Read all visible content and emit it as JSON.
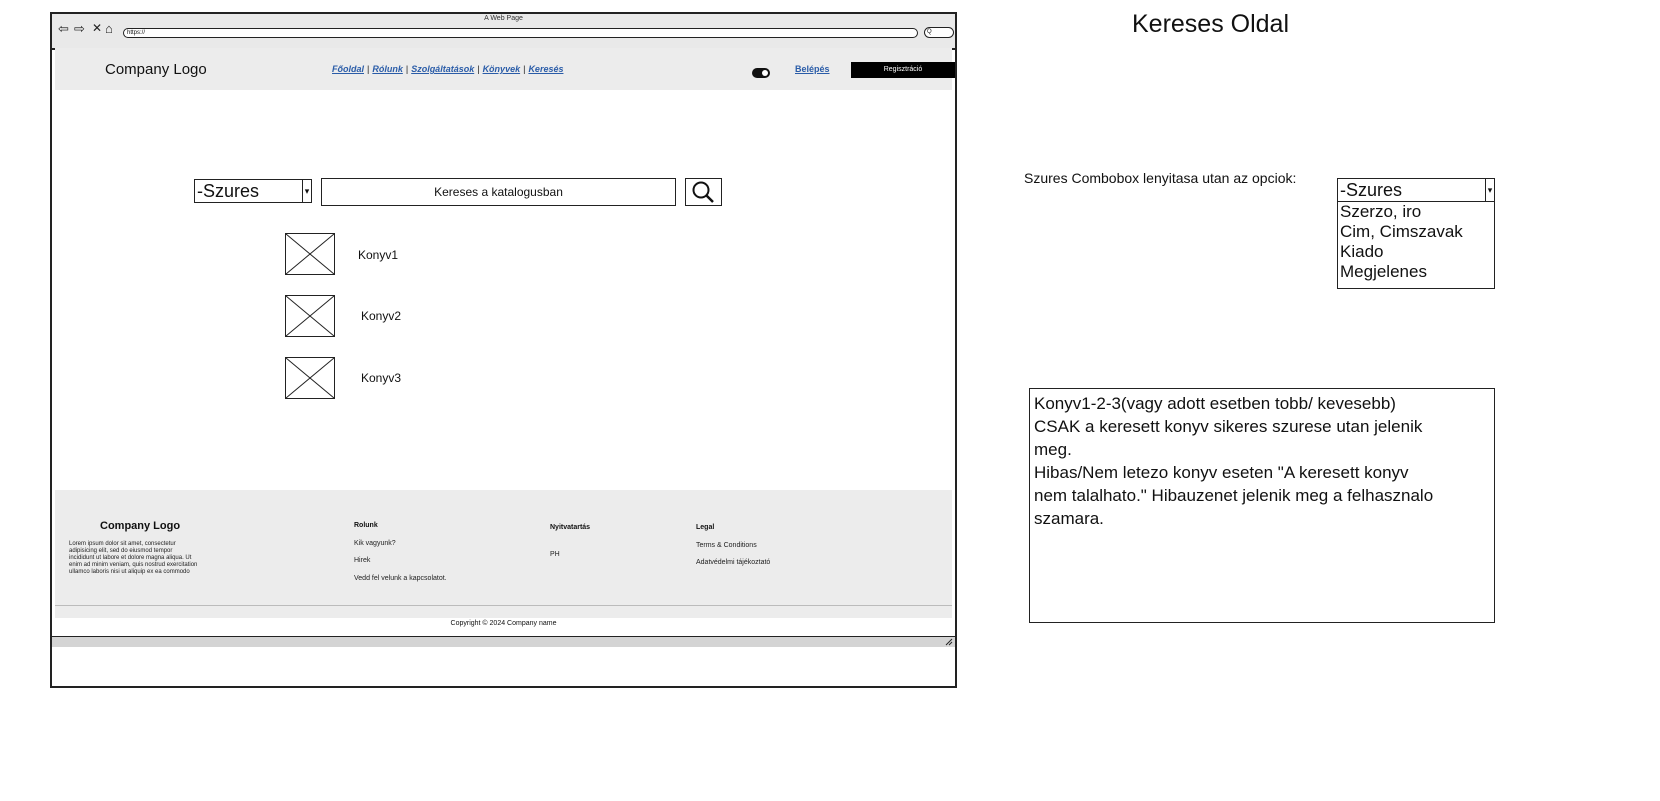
{
  "browser": {
    "title": "A Web Page",
    "address": "https://",
    "search": "Q",
    "controls": {
      "back": "⇦",
      "forward": "⇨",
      "stop": "✕",
      "home": "⌂"
    }
  },
  "header": {
    "logo": "Company Logo",
    "nav": [
      "Főoldal",
      "Rólunk",
      "Szolgáltatások",
      "Könyvek",
      "Keresés"
    ],
    "nav_separator": "|",
    "login": "Belépés",
    "register": "Regisztráció"
  },
  "search": {
    "filter_value": "-Szures",
    "input_text": "Kereses a katalogusban",
    "dropdown_arrow": "▾"
  },
  "results": [
    {
      "label": "Konyv1"
    },
    {
      "label": "Konyv2"
    },
    {
      "label": "Konyv3"
    }
  ],
  "footer": {
    "logo": "Company Logo",
    "lorem": "Lorem ipsum dolor sit amet, consectetur adipisicing elit, sed do eiusmod tempor incididunt ut labore et dolore magna aliqua. Ut enim ad minim veniam, quis nostrud exercitation ullamco laboris nisi ut aliquip ex ea commodo",
    "col1": {
      "heading": "Rolunk",
      "links": [
        "Kik vagyunk?",
        "Hirek",
        "Vedd fel velunk a kapcsolatot."
      ]
    },
    "col2": {
      "heading": "Nyitvatartás",
      "links": [
        "PH"
      ]
    },
    "col3": {
      "heading": "Legal",
      "links": [
        "Terms & Conditions",
        "Adatvédelmi tájékoztató"
      ]
    },
    "copyright": "Copyright © 2024 Company name"
  },
  "annotations": {
    "page_title": "Kereses Oldal",
    "combo_note": "Szures Combobox lenyitasa utan az opciok:",
    "combo_value": "-Szures",
    "combo_options": [
      "Szerzo, iro",
      "Cim, Cimszavak",
      "Kiado",
      "Megjelenes"
    ],
    "note": "Konyv1-2-3(vagy adott esetben tobb/ kevesebb)\nCSAK a keresett konyv sikeres szurese utan jelenik\nmeg.\nHibas/Nem letezo konyv eseten \"A keresett konyv\nnem talalhato.\" Hibauzenet jelenik meg a felhasznalo\nszamara."
  },
  "colors": {
    "link": "#2a5ca8",
    "header_bg": "#ececec",
    "button_bg": "#000000"
  }
}
